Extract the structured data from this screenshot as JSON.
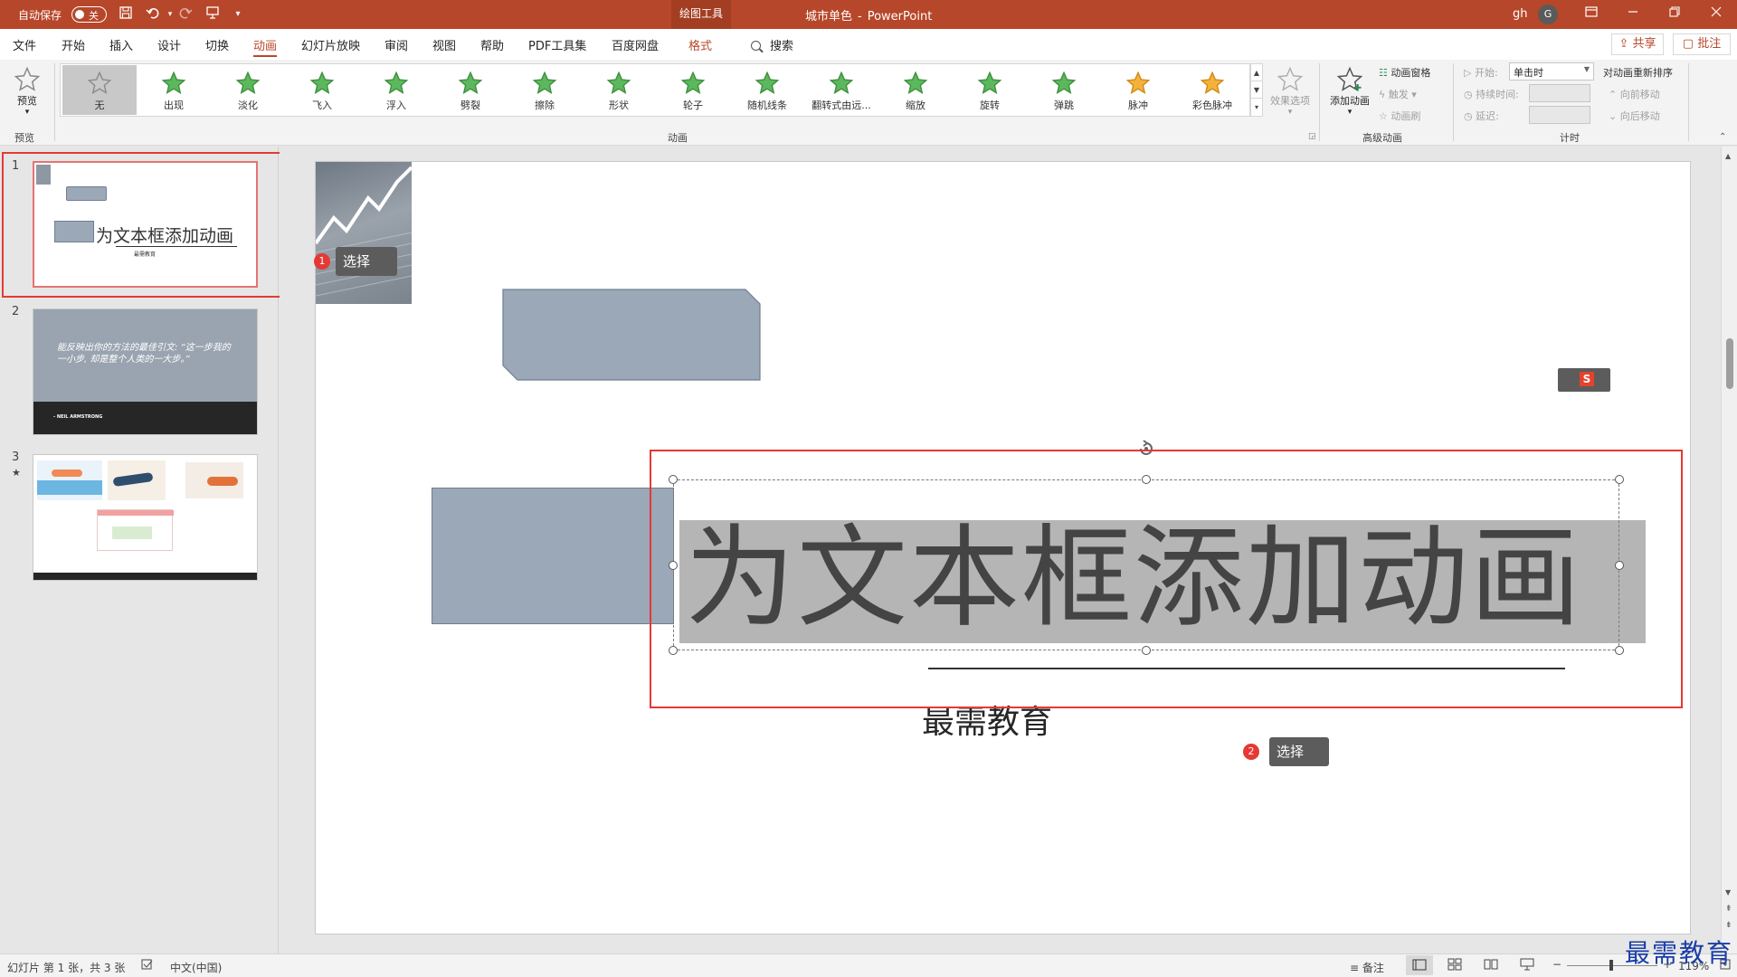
{
  "app": {
    "autosave_label": "自动保存",
    "autosave_state": "关",
    "context_tab": "绘图工具",
    "doc_name": "城市单色",
    "title_sep": "-",
    "app_name": "PowerPoint",
    "user_name": "gh",
    "user_initial": "G"
  },
  "tabs": [
    "文件",
    "开始",
    "插入",
    "设计",
    "切换",
    "动画",
    "幻灯片放映",
    "审阅",
    "视图",
    "帮助",
    "PDF工具集",
    "百度网盘",
    "格式"
  ],
  "active_tab": "动画",
  "search_label": "搜索",
  "share_label": "共享",
  "comment_label": "批注",
  "ribbon": {
    "preview_label": "预览",
    "preview_group": "预览",
    "animation_group": "动画",
    "animations": [
      "无",
      "出现",
      "淡化",
      "飞入",
      "浮入",
      "劈裂",
      "擦除",
      "形状",
      "轮子",
      "随机线条",
      "翻转式由远...",
      "缩放",
      "旋转",
      "弹跳",
      "脉冲",
      "彩色脉冲"
    ],
    "selected_animation": "无",
    "effect_options": "效果选项",
    "add_animation": "添加动画",
    "animation_pane": "动画窗格",
    "trigger": "触发",
    "animation_painter": "动画刷",
    "advanced_group": "高级动画",
    "start_label": "开始:",
    "start_value": "单击时",
    "duration_label": "持续时间:",
    "delay_label": "延迟:",
    "reorder_title": "对动画重新排序",
    "move_earlier": "向前移动",
    "move_later": "向后移动",
    "timing_group": "计时"
  },
  "slides": [
    {
      "number": "1",
      "title": "为文本框添加动画",
      "subtitle": "最需教育"
    },
    {
      "number": "2",
      "quote": "能反映出你的方法的最佳引文: “这一步我的一小步, 却是整个人类的一大步。”",
      "author": "- NEIL ARMSTRONG"
    },
    {
      "number": "3",
      "star": "★"
    }
  ],
  "main_slide": {
    "title": "为文本框添加动画",
    "subtitle": "最需教育"
  },
  "callouts": [
    {
      "number": "1",
      "label": "选择"
    },
    {
      "number": "2",
      "label": "选择"
    }
  ],
  "status": {
    "slide_info": "幻灯片 第 1 张，共 3 张",
    "language": "中文(中国)",
    "notes": "备注",
    "zoom": "119%"
  },
  "watermark": "最需教育",
  "colors": {
    "accent": "#b7472a",
    "callout": "#e53935",
    "shape": "#9aa8b8"
  }
}
